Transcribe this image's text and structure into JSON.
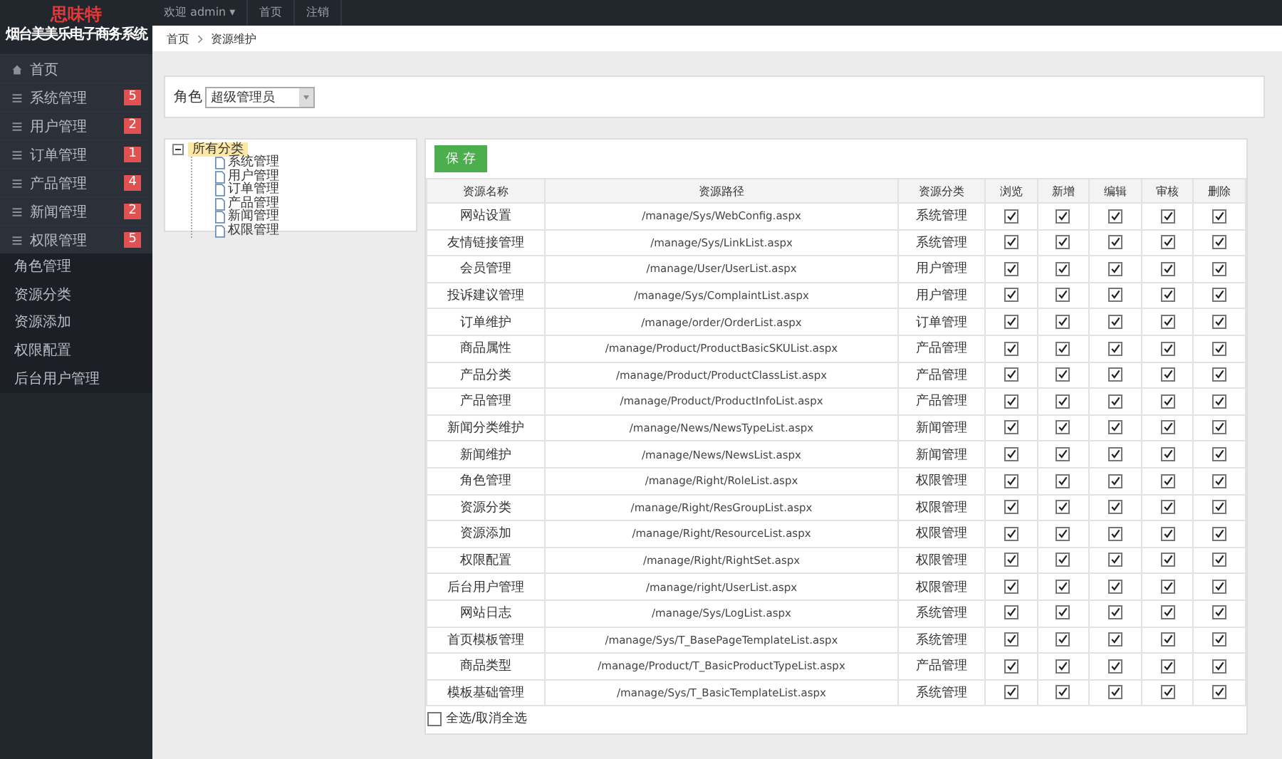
{
  "brand": {
    "logo": "思味特",
    "subtitle": "烟台美美乐电子商务系统"
  },
  "topbar": {
    "user": "欢迎 admin ▾",
    "home": "首页",
    "logout": "注销"
  },
  "breadcrumb": [
    "首页",
    "资源维护"
  ],
  "sidebar": {
    "items": [
      {
        "label": "首页",
        "kind": "home"
      },
      {
        "label": "系统管理",
        "badge": "5",
        "kind": "menu"
      },
      {
        "label": "用户管理",
        "badge": "2",
        "kind": "menu"
      },
      {
        "label": "订单管理",
        "badge": "1",
        "kind": "menu"
      },
      {
        "label": "产品管理",
        "badge": "4",
        "kind": "menu"
      },
      {
        "label": "新闻管理",
        "badge": "2",
        "kind": "menu"
      },
      {
        "label": "权限管理",
        "badge": "5",
        "kind": "menu",
        "children": [
          {
            "label": "角色管理"
          },
          {
            "label": "资源分类"
          },
          {
            "label": "资源添加"
          },
          {
            "label": "权限配置"
          },
          {
            "label": "后台用户管理"
          }
        ]
      }
    ]
  },
  "filter": {
    "label": "角色",
    "value": "超级管理员"
  },
  "tree": {
    "root": "所有分类",
    "expanded": true,
    "children": [
      "系统管理",
      "用户管理",
      "订单管理",
      "产品管理",
      "新闻管理",
      "权限管理"
    ]
  },
  "save_button": "保 存",
  "table": {
    "columns": [
      "资源名称",
      "资源路径",
      "资源分类",
      "浏览",
      "新增",
      "编辑",
      "审核",
      "删除"
    ],
    "rows": [
      {
        "name": "网站设置",
        "path": "/manage/Sys/WebConfig.aspx",
        "category": "系统管理",
        "checks": [
          true,
          true,
          true,
          true,
          true
        ]
      },
      {
        "name": "友情链接管理",
        "path": "/manage/Sys/LinkList.aspx",
        "category": "系统管理",
        "checks": [
          true,
          true,
          true,
          true,
          true
        ]
      },
      {
        "name": "会员管理",
        "path": "/manage/User/UserList.aspx",
        "category": "用户管理",
        "checks": [
          true,
          true,
          true,
          true,
          true
        ]
      },
      {
        "name": "投诉建议管理",
        "path": "/manage/Sys/ComplaintList.aspx",
        "category": "用户管理",
        "checks": [
          true,
          true,
          true,
          true,
          true
        ]
      },
      {
        "name": "订单维护",
        "path": "/manage/order/OrderList.aspx",
        "category": "订单管理",
        "checks": [
          true,
          true,
          true,
          true,
          true
        ]
      },
      {
        "name": "商品属性",
        "path": "/manage/Product/ProductBasicSKUList.aspx",
        "category": "产品管理",
        "checks": [
          true,
          true,
          true,
          true,
          true
        ]
      },
      {
        "name": "产品分类",
        "path": "/manage/Product/ProductClassList.aspx",
        "category": "产品管理",
        "checks": [
          true,
          true,
          true,
          true,
          true
        ]
      },
      {
        "name": "产品管理",
        "path": "/manage/Product/ProductInfoList.aspx",
        "category": "产品管理",
        "checks": [
          true,
          true,
          true,
          true,
          true
        ]
      },
      {
        "name": "新闻分类维护",
        "path": "/manage/News/NewsTypeList.aspx",
        "category": "新闻管理",
        "checks": [
          true,
          true,
          true,
          true,
          true
        ]
      },
      {
        "name": "新闻维护",
        "path": "/manage/News/NewsList.aspx",
        "category": "新闻管理",
        "checks": [
          true,
          true,
          true,
          true,
          true
        ]
      },
      {
        "name": "角色管理",
        "path": "/manage/Right/RoleList.aspx",
        "category": "权限管理",
        "checks": [
          true,
          true,
          true,
          true,
          true
        ]
      },
      {
        "name": "资源分类",
        "path": "/manage/Right/ResGroupList.aspx",
        "category": "权限管理",
        "checks": [
          true,
          true,
          true,
          true,
          true
        ]
      },
      {
        "name": "资源添加",
        "path": "/manage/Right/ResourceList.aspx",
        "category": "权限管理",
        "checks": [
          true,
          true,
          true,
          true,
          true
        ]
      },
      {
        "name": "权限配置",
        "path": "/manage/Right/RightSet.aspx",
        "category": "权限管理",
        "checks": [
          true,
          true,
          true,
          true,
          true
        ]
      },
      {
        "name": "后台用户管理",
        "path": "/manage/right/UserList.aspx",
        "category": "权限管理",
        "checks": [
          true,
          true,
          true,
          true,
          true
        ]
      },
      {
        "name": "网站日志",
        "path": "/manage/Sys/LogList.aspx",
        "category": "系统管理",
        "checks": [
          true,
          true,
          true,
          true,
          true
        ]
      },
      {
        "name": "首页模板管理",
        "path": "/manage/Sys/T_BasePageTemplateList.aspx",
        "category": "系统管理",
        "checks": [
          true,
          true,
          true,
          true,
          true
        ]
      },
      {
        "name": "商品类型",
        "path": "/manage/Product/T_BasicProductTypeList.aspx",
        "category": "产品管理",
        "checks": [
          true,
          true,
          true,
          true,
          true
        ]
      },
      {
        "name": "模板基础管理",
        "path": "/manage/Sys/T_BasicTemplateList.aspx",
        "category": "系统管理",
        "checks": [
          true,
          true,
          true,
          true,
          true
        ]
      }
    ]
  },
  "select_all": {
    "label": "全选/取消全选",
    "checked": false
  }
}
